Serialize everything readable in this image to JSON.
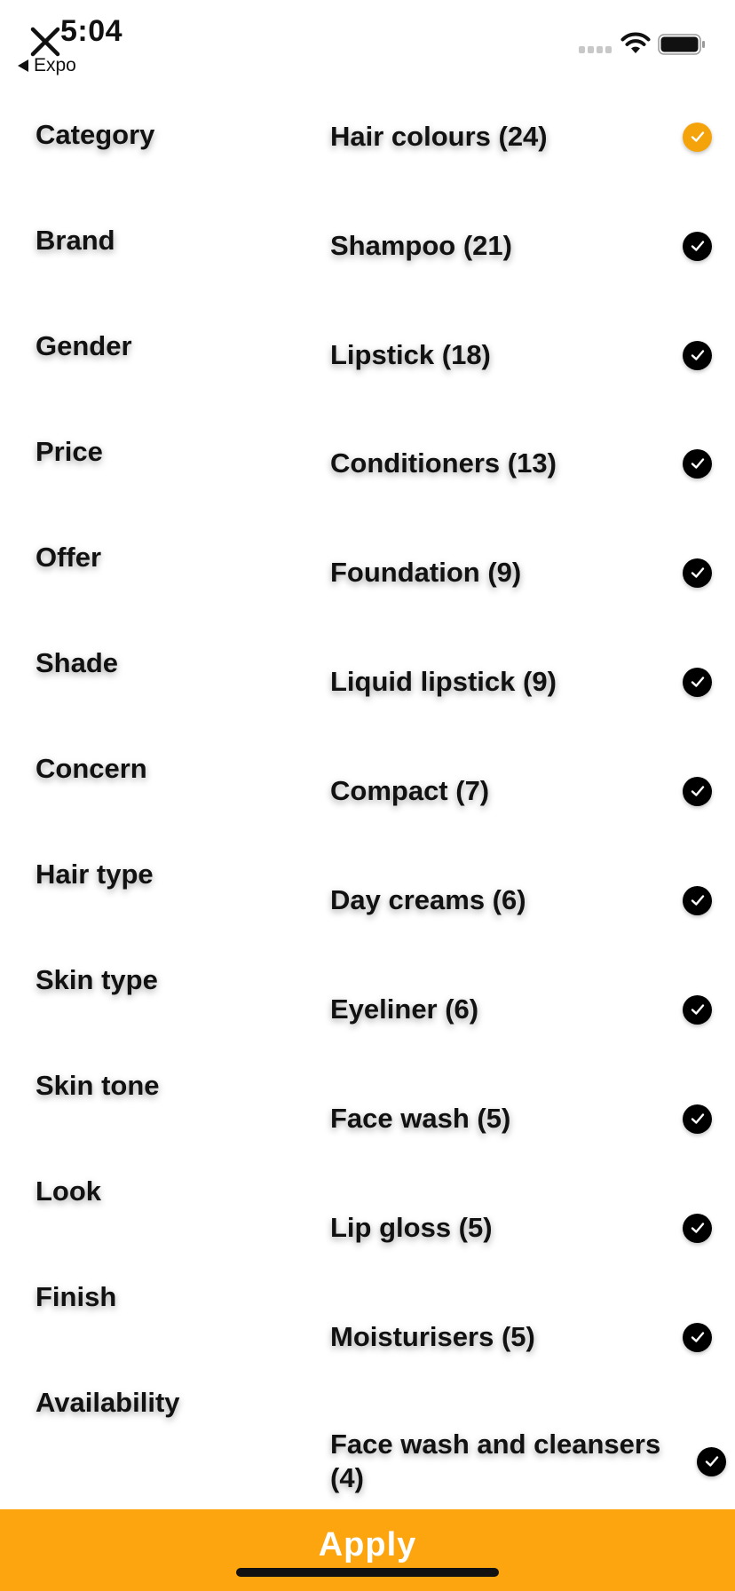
{
  "status_bar": {
    "time": "5:04",
    "back_label": "Expo"
  },
  "filter_categories": [
    {
      "label": "Category"
    },
    {
      "label": "Brand"
    },
    {
      "label": "Gender"
    },
    {
      "label": "Price"
    },
    {
      "label": "Offer"
    },
    {
      "label": "Shade"
    },
    {
      "label": "Concern"
    },
    {
      "label": "Hair type"
    },
    {
      "label": "Skin type"
    },
    {
      "label": "Skin tone"
    },
    {
      "label": "Look"
    },
    {
      "label": "Finish"
    },
    {
      "label": "Availability"
    }
  ],
  "options": [
    {
      "label": "Hair colours (24)",
      "selected": true
    },
    {
      "label": "Shampoo (21)",
      "selected": false
    },
    {
      "label": "Lipstick (18)",
      "selected": false
    },
    {
      "label": "Conditioners (13)",
      "selected": false
    },
    {
      "label": "Foundation (9)",
      "selected": false
    },
    {
      "label": "Liquid lipstick (9)",
      "selected": false
    },
    {
      "label": "Compact (7)",
      "selected": false
    },
    {
      "label": "Day creams (6)",
      "selected": false
    },
    {
      "label": "Eyeliner (6)",
      "selected": false
    },
    {
      "label": "Face wash (5)",
      "selected": false
    },
    {
      "label": "Lip gloss (5)",
      "selected": false
    },
    {
      "label": "Moisturisers (5)",
      "selected": false
    },
    {
      "label": "Face wash and cleansers (4)",
      "selected": false
    }
  ],
  "apply_label": "Apply",
  "colors": {
    "accent": "#f5a30b",
    "check_unselected": "#000000",
    "apply_background": "#fda50f"
  }
}
